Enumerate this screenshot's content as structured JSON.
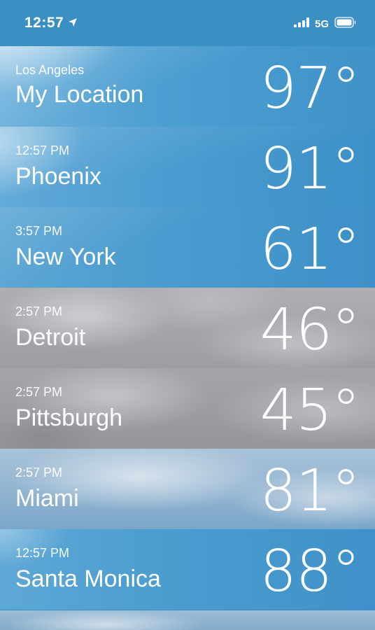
{
  "status_bar": {
    "time": "12:57",
    "network": "5G",
    "icons": [
      "location-arrow-icon",
      "signal-bars-icon",
      "battery-icon"
    ]
  },
  "locations": [
    {
      "subtitle": "Los Angeles",
      "name": "My Location",
      "temperature": "97°",
      "condition_bg": "clear"
    },
    {
      "subtitle": "12:57 PM",
      "name": "Phoenix",
      "temperature": "91°",
      "condition_bg": "clear"
    },
    {
      "subtitle": "3:57 PM",
      "name": "New York",
      "temperature": "61°",
      "condition_bg": "clear"
    },
    {
      "subtitle": "2:57 PM",
      "name": "Detroit",
      "temperature": "46°",
      "condition_bg": "cloudy"
    },
    {
      "subtitle": "2:57 PM",
      "name": "Pittsburgh",
      "temperature": "45°",
      "condition_bg": "cloudy"
    },
    {
      "subtitle": "2:57 PM",
      "name": "Miami",
      "temperature": "81°",
      "condition_bg": "partly-cloudy"
    },
    {
      "subtitle": "12:57 PM",
      "name": "Santa Monica",
      "temperature": "88°",
      "condition_bg": "clear"
    }
  ],
  "colors": {
    "clear_sky": "#4a9cd0",
    "cloudy": "#a2a2a8",
    "partly_cloudy": "#8fb2cf",
    "text": "#ffffff"
  }
}
